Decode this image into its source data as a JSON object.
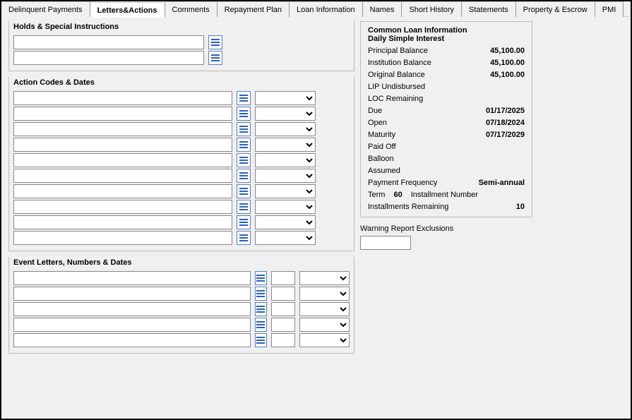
{
  "tabs": {
    "t0": "Delinquent Payments",
    "t1": "Letters&Actions",
    "t2": "Comments",
    "t3": "Repayment Plan",
    "t4": "Loan Information",
    "t5": "Names",
    "t6": "Short History",
    "t7": "Statements",
    "t8": "Property & Escrow",
    "t9": "PMI"
  },
  "groups": {
    "holds_title": "Holds & Special Instructions",
    "actions_title": "Action Codes & Dates",
    "events_title": "Event Letters, Numbers & Dates"
  },
  "holds": {
    "r0": "",
    "r1": ""
  },
  "actions": {
    "r0": "",
    "r1": "",
    "r2": "",
    "r3": "",
    "r4": "",
    "r5": "",
    "r6": "",
    "r7": "",
    "r8": "",
    "r9": ""
  },
  "events": {
    "r0": {
      "text": "",
      "num": ""
    },
    "r1": {
      "text": "",
      "num": ""
    },
    "r2": {
      "text": "",
      "num": ""
    },
    "r3": {
      "text": "",
      "num": ""
    },
    "r4": {
      "text": "",
      "num": ""
    }
  },
  "info": {
    "title": "Common Loan Information",
    "sub": "Daily Simple Interest",
    "rows": {
      "principal_label": "Principal Balance",
      "principal_val": "45,100.00",
      "inst_label": "Institution Balance",
      "inst_val": "45,100.00",
      "orig_label": "Original Balance",
      "orig_val": "45,100.00",
      "lip_label": "LIP Undisbursed",
      "lip_val": "",
      "loc_label": "LOC Remaining",
      "loc_val": "",
      "due_label": "Due",
      "due_val": "01/17/2025",
      "open_label": "Open",
      "open_val": "07/18/2024",
      "mat_label": "Maturity",
      "mat_val": "07/17/2029",
      "paid_label": "Paid Off",
      "paid_val": "",
      "balloon_label": "Balloon",
      "balloon_val": "",
      "assumed_label": "Assumed",
      "assumed_val": "",
      "freq_label": "Payment Frequency",
      "freq_val": "Semi-annual",
      "term_label": "Term",
      "term_val": "60",
      "instnum_label": "Installment Number",
      "instnum_val": "",
      "remain_label": "Installments Remaining",
      "remain_val": "10"
    }
  },
  "warn": {
    "label": "Warning Report Exclusions",
    "value": ""
  }
}
